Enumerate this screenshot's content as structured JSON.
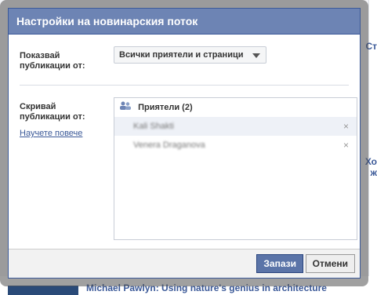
{
  "dialog": {
    "title": "Настройки на новинарския поток",
    "show_from_label": "Показвай публикации от:",
    "show_from_value": "Всички приятели и страници",
    "hide_from_label": "Скривай публикации от:",
    "learn_more": "Научете повече",
    "list": {
      "header": "Приятели (2)",
      "items": [
        {
          "name": "Kali Shakti"
        },
        {
          "name": "Venera Draganova"
        }
      ],
      "remove_glyph": "×"
    },
    "buttons": {
      "save": "Запази",
      "cancel": "Отмени"
    }
  },
  "background": {
    "right_snippet_1": "Ст",
    "right_snippet_2": "Хо",
    "right_snippet_3": "ж",
    "bottom_title": "Michael Pawlyn: Using nature's genius in architecture"
  },
  "colors": {
    "header_bg": "#6d84b4",
    "brand": "#3b5998",
    "save_bg": "#5b74a8"
  }
}
